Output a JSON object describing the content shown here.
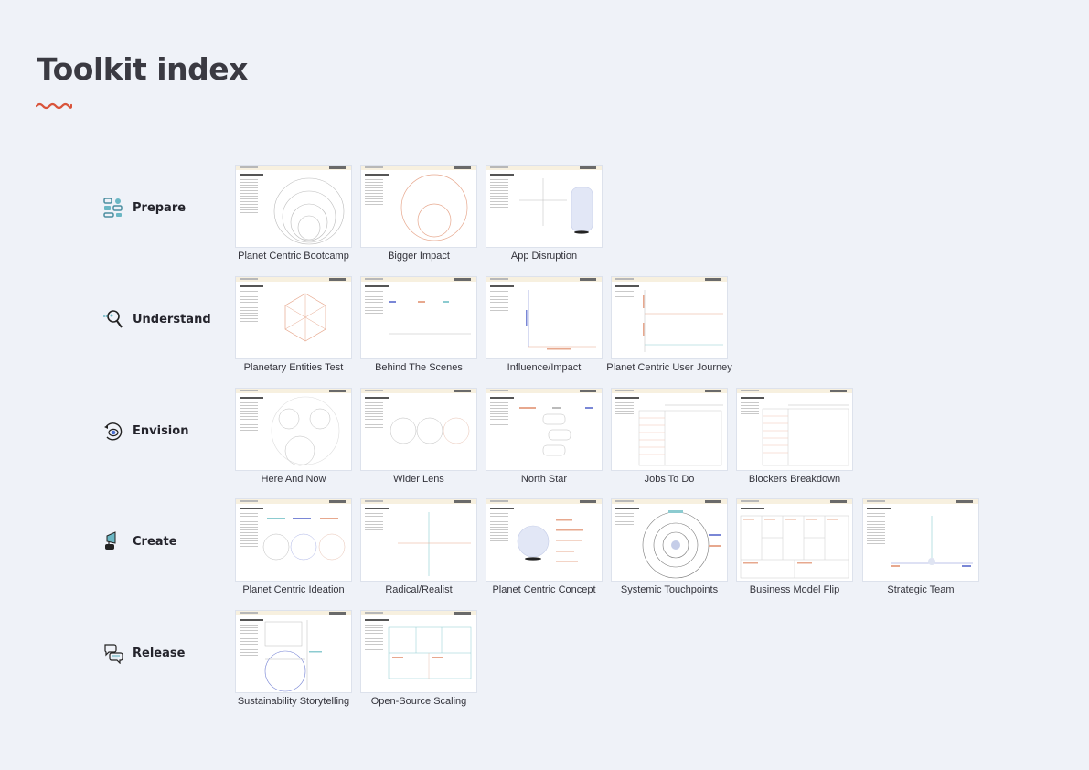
{
  "page": {
    "title": "Toolkit index"
  },
  "colors": {
    "background": "#eff2f8",
    "accent": "#d9543b",
    "teal": "#5aa9b3"
  },
  "phases": [
    {
      "label": "Prepare",
      "icon": "blocks-icon",
      "cards": [
        "Planet Centric Bootcamp",
        "Bigger Impact",
        "App Disruption"
      ]
    },
    {
      "label": "Understand",
      "icon": "magnifier-icon",
      "cards": [
        "Planetary Entities Test",
        "Behind The Scenes",
        "Influence/Impact",
        "Planet Centric User Journey"
      ]
    },
    {
      "label": "Envision",
      "icon": "eye-icon",
      "cards": [
        "Here And Now",
        "Wider Lens",
        "North Star",
        "Jobs To Do",
        "Blockers Breakdown"
      ]
    },
    {
      "label": "Create",
      "icon": "megaphone-icon",
      "cards": [
        "Planet Centric Ideation",
        "Radical/Realist",
        "Planet Centric Concept",
        "Systemic Touchpoints",
        "Business Model Flip",
        "Strategic Team"
      ]
    },
    {
      "label": "Release",
      "icon": "speech-bubbles-icon",
      "cards": [
        "Sustainability Storytelling",
        "Open-Source Scaling"
      ]
    }
  ]
}
